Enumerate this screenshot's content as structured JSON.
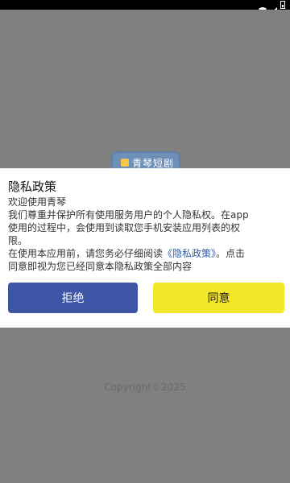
{
  "background": {
    "app_logo_text": "青琴短剧",
    "copyright": "Copyright©2025"
  },
  "modal": {
    "title": "隐私政策",
    "welcome": "欢迎使用青琴",
    "body_line1": "我们尊重并保护所有使用服务用户的个人隐私权。在app",
    "body_line2": "使用的过程中，会使用到读取您手机安装应用列表的权",
    "body_line3": "限。",
    "body_line4_before": "在使用本应用前，请您务必仔细阅读",
    "policy_link": "《隐私政策》",
    "body_line4_after": "。点击",
    "body_line5": "同意即视为您已经同意本隐私政策全部内容",
    "reject_label": "拒绝",
    "agree_label": "同意"
  },
  "colors": {
    "reject_button": "#3e55a6",
    "agree_button": "#f4e629",
    "link": "#2b5ca8",
    "overlay": "#808080"
  },
  "status_icons": [
    "wifi-icon",
    "signal-icon",
    "battery-icon"
  ]
}
